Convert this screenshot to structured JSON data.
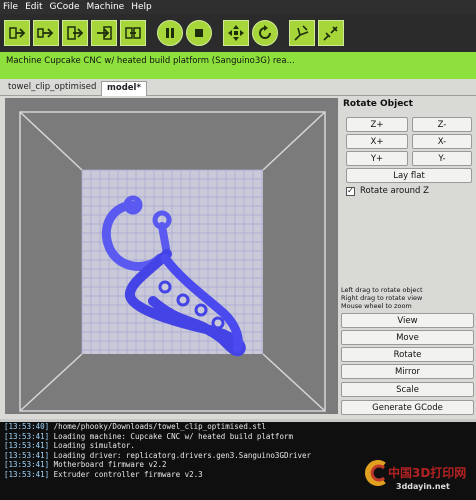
{
  "menu": [
    "File",
    "Edit",
    "GCode",
    "Machine",
    "Help"
  ],
  "toolbar": {
    "icons": [
      "arrow-right-icon",
      "arrow-right-icon",
      "arrow-right-icon",
      "arrow-right-icon",
      "arrow-right-icon",
      "pause-icon",
      "stop-icon",
      "move-arrows-icon",
      "refresh-icon",
      "plug-icon",
      "unplug-icon"
    ],
    "accent_color": "#a7d63b"
  },
  "status": {
    "machine": "Machine Cupcake CNC w/ heated build platform (Sanguino3G) rea...",
    "color": "#8ee03c"
  },
  "tabs": [
    "towel_clip_optimised",
    "model*"
  ],
  "panel": {
    "title": "Rotate Object",
    "rotate_buttons": [
      "Z+",
      "Z-",
      "X+",
      "X-",
      "Y+",
      "Y-"
    ],
    "lay_flat": "Lay flat",
    "checkbox_mark": "✓",
    "checkbox_label": "Rotate around Z",
    "hints": [
      "Left drag to rotate object",
      "Right drag to rotate view",
      "Mouse wheel to zoom"
    ],
    "mode_buttons": [
      "View",
      "Move",
      "Rotate",
      "Mirror",
      "Scale",
      "Generate GCode"
    ]
  },
  "console": [
    {
      "time": "[13:53:40]",
      "text": "/home/phooky/Downloads/towel_clip_optimised.stl"
    },
    {
      "time": "[13:53:41]",
      "text": "Loading machine: Cupcake CNC w/ heated build platform"
    },
    {
      "time": "[13:53:41]",
      "text": "Loading simulator."
    },
    {
      "time": "[13:53:41]",
      "text": "Loading driver: replicatorg.drivers.gen3.Sanguino3GDriver"
    },
    {
      "time": "[13:53:41]",
      "text": "Motherboard firmware v2.2"
    },
    {
      "time": "[13:53:41]",
      "text": "Extruder controller firmware v2.3"
    }
  ],
  "watermark": {
    "text": "中国3D打印网",
    "url": "3ddayin.net"
  },
  "colors": {
    "model": "#4343e6",
    "platform": "#c9c9d9",
    "viewport_bg": "#7b7b7b"
  }
}
